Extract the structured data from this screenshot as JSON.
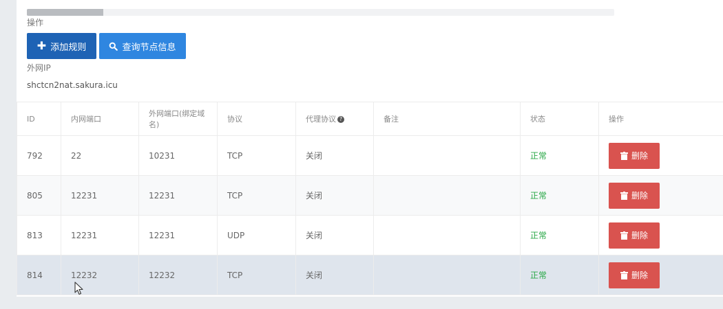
{
  "progress": {
    "fraction": 0.13
  },
  "actions_label": "操作",
  "buttons": {
    "add_rule": "添加规则",
    "query_node": "查询节点信息"
  },
  "external_ip_label": "外网IP",
  "external_ip_value": "shctcn2nat.sakura.icu",
  "table": {
    "headers": {
      "id": "ID",
      "local_port": "内网端口",
      "remote_port": "外网端口(绑定域名)",
      "protocol": "协议",
      "proxy_protocol": "代理协议",
      "note": "备注",
      "status": "状态",
      "action": "操作"
    },
    "rows": [
      {
        "id": "792",
        "local_port": "22",
        "remote_port": "10231",
        "protocol": "TCP",
        "proxy_protocol": "关闭",
        "note": "",
        "status": "正常",
        "delete_label": "删除"
      },
      {
        "id": "805",
        "local_port": "12231",
        "remote_port": "12231",
        "protocol": "TCP",
        "proxy_protocol": "关闭",
        "note": "",
        "status": "正常",
        "delete_label": "删除"
      },
      {
        "id": "813",
        "local_port": "12231",
        "remote_port": "12231",
        "protocol": "UDP",
        "proxy_protocol": "关闭",
        "note": "",
        "status": "正常",
        "delete_label": "删除"
      },
      {
        "id": "814",
        "local_port": "12232",
        "remote_port": "12232",
        "protocol": "TCP",
        "proxy_protocol": "关闭",
        "note": "",
        "status": "正常",
        "delete_label": "删除"
      }
    ]
  },
  "colors": {
    "primary": "#1e63b5",
    "info": "#2f86e0",
    "danger": "#d9534f",
    "success": "#27a745"
  },
  "icons": {
    "add": "plus-icon",
    "query": "search-icon",
    "delete": "trash-icon",
    "help": "question-circle-icon",
    "cursor": "mouse-pointer-icon"
  }
}
